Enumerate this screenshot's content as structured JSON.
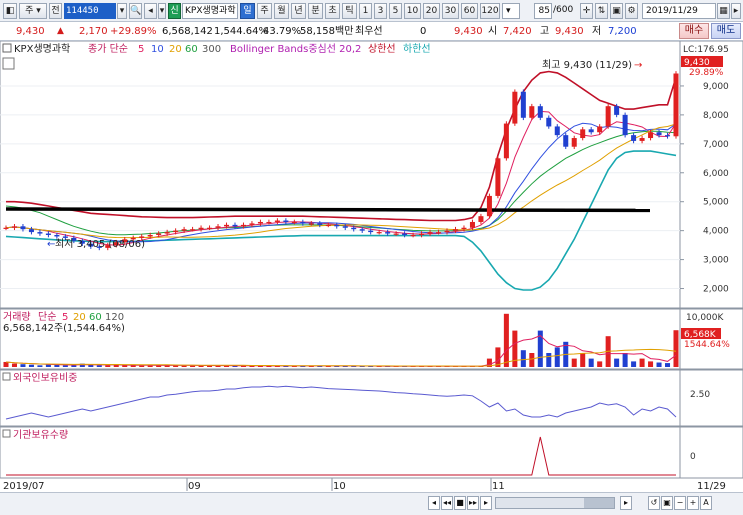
{
  "toolbar": {
    "jeon_label": "전",
    "stock_code": "114450",
    "shin_badge": "신",
    "stock_name": "KPX생명과학",
    "period_tabs": [
      "일",
      "주",
      "월",
      "년",
      "분",
      "초",
      "틱"
    ],
    "minute_options": [
      "1",
      "3",
      "5",
      "10",
      "20",
      "30",
      "60",
      "120"
    ],
    "page_count": "85",
    "page_total": "/600",
    "date": "2019/11/29"
  },
  "quote": {
    "price": "9,430",
    "change": "2,170",
    "change_pct": "+29.89%",
    "volume": "6,568,142",
    "volume_ratio": "1,544.64%",
    "turnover_pct": "43.79%",
    "amount": "58,158백만",
    "cwu_label": "최우선",
    "cwu_value": "0",
    "close": "9,430",
    "open_label": "시",
    "open": "7,420",
    "high_label": "고",
    "high": "9,430",
    "low_label": "저",
    "low": "7,200",
    "buy_label": "매수",
    "sell_label": "매도"
  },
  "legend": {
    "name": "KPX생명과학",
    "ma_label": "종가 단순",
    "ma_periods": [
      "5",
      "10",
      "20",
      "60",
      "300"
    ],
    "bb_label": "Bollinger Bands중심선 20,2",
    "bb_upper": "상한선",
    "bb_lower": "하한선"
  },
  "price_panel": {
    "lc": "LC:176.95",
    "current": "9,430",
    "pct": "29.89%",
    "max_label": "최고 9,430 (11/29)",
    "min_label": "최저 3,405 (08/06)",
    "y_ticks": [
      "9,000",
      "8,000",
      "7,000",
      "6,000",
      "5,000",
      "4,000",
      "3,000",
      "2,000"
    ]
  },
  "volume_panel": {
    "title": "거래량",
    "ma_label": "단순",
    "ma_periods": [
      "5",
      "20",
      "60",
      "120"
    ],
    "value_text": "6,568,142주(1,544.64%)",
    "axis_top": "10,000K",
    "badge": "6,568K",
    "badge_pct": "1544.64%"
  },
  "foreign_panel": {
    "title": "외국인보유비중",
    "tick": "2.50"
  },
  "inst_panel": {
    "title": "기관보유수량",
    "tick": "0"
  },
  "x_axis": {
    "labels": [
      "2019/07",
      "09",
      "10",
      "11",
      "11/29"
    ]
  },
  "colors": {
    "up": "#e02020",
    "down": "#2040d0",
    "bb_upper": "#c01028",
    "bb_lower": "#18a8b0",
    "ma5": "#e02060",
    "ma10": "#3050e0",
    "ma20": "#e0a000",
    "ma60": "#20a040",
    "trendline": "#000000"
  },
  "chart_data": [
    {
      "type": "candlestick",
      "title": "KPX생명과학",
      "period": "2019/07 ~ 2019/11/29",
      "x_labels": [
        "2019/07",
        "09",
        "10",
        "11",
        "11/29"
      ],
      "ylim": [
        1500,
        10000
      ],
      "annotations": [
        {
          "text": "최고 9,430 (11/29)",
          "value": 9430
        },
        {
          "text": "최저 3,405 (08/06)",
          "value": 3405
        }
      ],
      "trendline_level": [
        4750,
        4700
      ],
      "series": [
        {
          "name": "price",
          "values": [
            4100,
            4150,
            4050,
            3950,
            3900,
            3850,
            3800,
            3750,
            3650,
            3550,
            3450,
            3405,
            3500,
            3600,
            3700,
            3750,
            3800,
            3850,
            3900,
            3950,
            4000,
            4050,
            4050,
            4100,
            4100,
            4150,
            4200,
            4150,
            4200,
            4250,
            4300,
            4300,
            4350,
            4300,
            4300,
            4250,
            4250,
            4200,
            4200,
            4150,
            4100,
            4050,
            4000,
            3950,
            3950,
            3900,
            3900,
            3850,
            3850,
            3900,
            3950,
            3950,
            4000,
            4050,
            4100,
            4300,
            4500,
            5200,
            6500,
            7700,
            8800,
            7900,
            8300,
            7900,
            7600,
            7300,
            6900,
            7200,
            7500,
            7400,
            7600,
            8300,
            8000,
            7300,
            7100,
            7200,
            7400,
            7300,
            7260,
            9430
          ]
        },
        {
          "name": "중심선",
          "values": [
            4850,
            4820,
            4780,
            4700,
            4620,
            4500,
            4380,
            4260,
            4150,
            4060,
            3980,
            3920,
            3880,
            3860,
            3860,
            3870,
            3880,
            3900,
            3920,
            3950,
            3980,
            4000,
            4020,
            4040,
            4060,
            4080,
            4100,
            4110,
            4120,
            4140,
            4160,
            4180,
            4190,
            4200,
            4200,
            4200,
            4200,
            4200,
            4190,
            4180,
            4170,
            4150,
            4130,
            4110,
            4090,
            4070,
            4050,
            4030,
            4010,
            4000,
            3990,
            3990,
            3990,
            4000,
            4010,
            4020,
            4080,
            4180,
            4380,
            4680,
            5020,
            5320,
            5620,
            5880,
            6100,
            6300,
            6500,
            6650,
            6800,
            6930,
            7040,
            7150,
            7250,
            7330,
            7380,
            7420,
            7440,
            7430,
            7400,
            7380
          ]
        },
        {
          "name": "상한선",
          "values": [
            5000,
            5000,
            4980,
            4950,
            4900,
            4850,
            4800,
            4750,
            4700,
            4650,
            4600,
            4580,
            4560,
            4540,
            4520,
            4500,
            4480,
            4470,
            4460,
            4450,
            4450,
            4450,
            4450,
            4460,
            4470,
            4480,
            4490,
            4500,
            4500,
            4500,
            4500,
            4500,
            4500,
            4500,
            4500,
            4500,
            4490,
            4480,
            4470,
            4460,
            4450,
            4440,
            4430,
            4420,
            4410,
            4400,
            4390,
            4380,
            4370,
            4360,
            4350,
            4350,
            4350,
            4350,
            4380,
            4450,
            4800,
            5500,
            6600,
            7500,
            8200,
            8800,
            9200,
            9450,
            9500,
            9450,
            9300,
            9100,
            8900,
            8700,
            8500,
            8400,
            8300,
            8200,
            8200,
            8250,
            8300,
            8350,
            8350,
            9300
          ]
        },
        {
          "name": "하한선",
          "values": [
            3800,
            3780,
            3760,
            3740,
            3720,
            3700,
            3680,
            3660,
            3650,
            3640,
            3630,
            3620,
            3620,
            3620,
            3620,
            3630,
            3640,
            3650,
            3660,
            3670,
            3680,
            3690,
            3700,
            3710,
            3720,
            3730,
            3740,
            3750,
            3760,
            3770,
            3780,
            3790,
            3800,
            3810,
            3820,
            3830,
            3830,
            3830,
            3830,
            3830,
            3830,
            3830,
            3830,
            3830,
            3830,
            3830,
            3830,
            3830,
            3830,
            3830,
            3830,
            3830,
            3830,
            3830,
            3800,
            3600,
            3300,
            2900,
            2500,
            2200,
            2000,
            1950,
            1950,
            2050,
            2300,
            2700,
            3200,
            3700,
            4300,
            4900,
            5500,
            6100,
            6500,
            6700,
            6750,
            6750,
            6750,
            6700,
            6650,
            6600
          ]
        }
      ]
    },
    {
      "type": "bar",
      "title": "거래량",
      "ylim": [
        0,
        10000
      ],
      "unit": "K",
      "series": [
        {
          "name": "거래량",
          "values": [
            900,
            600,
            500,
            400,
            300,
            500,
            400,
            300,
            300,
            600,
            400,
            300,
            300,
            400,
            300,
            300,
            250,
            250,
            300,
            300,
            300,
            250,
            250,
            250,
            250,
            250,
            250,
            200,
            200,
            200,
            200,
            200,
            200,
            200,
            200,
            200,
            200,
            200,
            200,
            200,
            200,
            150,
            150,
            150,
            150,
            150,
            150,
            150,
            150,
            150,
            150,
            150,
            150,
            150,
            150,
            150,
            200,
            1500,
            3500,
            9500,
            6500,
            3000,
            2500,
            6500,
            2500,
            3500,
            4500,
            1500,
            2500,
            1500,
            1000,
            5500,
            1500,
            2500,
            1000,
            1500,
            1000,
            800,
            700,
            6568
          ]
        }
      ]
    },
    {
      "type": "line",
      "title": "외국인보유비중",
      "series": [
        {
          "name": "외국인보유비중",
          "values": [
            2.0,
            2.05,
            2.1,
            2.15,
            2.1,
            2.05,
            2.1,
            2.15,
            2.2,
            2.25,
            2.2,
            2.25,
            2.3,
            2.35,
            2.4,
            2.45,
            2.5,
            2.55,
            2.55,
            2.6,
            2.62,
            2.65,
            2.68,
            2.7,
            2.7,
            2.72,
            2.75,
            2.75,
            2.78,
            2.8,
            2.8,
            2.82,
            2.8,
            2.82,
            2.8,
            2.78,
            2.8,
            2.78,
            2.76,
            2.75,
            2.74,
            2.73,
            2.72,
            2.71,
            2.7,
            2.68,
            2.66,
            2.65,
            2.63,
            2.62,
            2.6,
            2.58,
            2.57,
            2.58,
            2.6,
            2.58,
            2.45,
            2.3,
            2.4,
            2.2,
            2.25,
            2.1,
            2.05,
            2.05,
            2.1,
            2.05,
            2.15,
            2.2,
            2.25,
            2.3,
            2.4,
            2.35,
            2.38,
            2.3,
            2.1,
            2.25,
            2.2,
            2.3,
            2.25,
            2.05
          ]
        }
      ]
    },
    {
      "type": "line",
      "title": "기관보유수량",
      "series": [
        {
          "name": "기관보유수량",
          "values": [
            0,
            0,
            0,
            0,
            0,
            0,
            0,
            0,
            0,
            0,
            0,
            0,
            0,
            0,
            0,
            0,
            0,
            0,
            0,
            0,
            0,
            0,
            0,
            0,
            0,
            0,
            0,
            0,
            0,
            0,
            0,
            0,
            0,
            0,
            0,
            0,
            0,
            0,
            0,
            0,
            0,
            0,
            0,
            0,
            0,
            0,
            0,
            0,
            0,
            0,
            0,
            0,
            0,
            0,
            0,
            0,
            0,
            0,
            0,
            0,
            0,
            0,
            0,
            1,
            0,
            0,
            0,
            0,
            0,
            0,
            0,
            0,
            0,
            0,
            0,
            0,
            0,
            0,
            0,
            0
          ]
        }
      ]
    }
  ]
}
